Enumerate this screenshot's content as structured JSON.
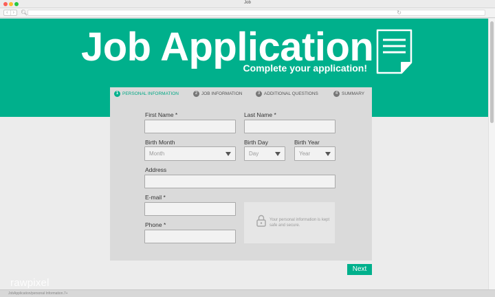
{
  "window": {
    "title": "Job"
  },
  "browser": {
    "back": "‹",
    "forward": "›"
  },
  "hero": {
    "title": "Job Application",
    "subtitle": "Complete your application!"
  },
  "steps": [
    {
      "num": "1",
      "label": "PERSONAL INFORMATION"
    },
    {
      "num": "2",
      "label": "JOB INFORMATION"
    },
    {
      "num": "3",
      "label": "ADDITIONAL QUESTIONS"
    },
    {
      "num": "4",
      "label": "SUMMARY"
    }
  ],
  "form": {
    "first_name_label": "First Name *",
    "last_name_label": "Last Name *",
    "birth_month_label": "Birth Month",
    "birth_month_value": "Month",
    "birth_day_label": "Birth Day",
    "birth_day_value": "Day",
    "birth_year_label": "Birth Year",
    "birth_year_value": "Year",
    "address_label": "Address",
    "email_label": "E-mail *",
    "phone_label": "Phone *",
    "secure_note": "Your personal information is kept safe and secure."
  },
  "next_label": "Next",
  "watermark": "rawpixel",
  "status_text": "JobApplication/personal Information.7+",
  "colors": {
    "accent": "#00b08c",
    "card": "#dadada",
    "page": "#ececec"
  }
}
